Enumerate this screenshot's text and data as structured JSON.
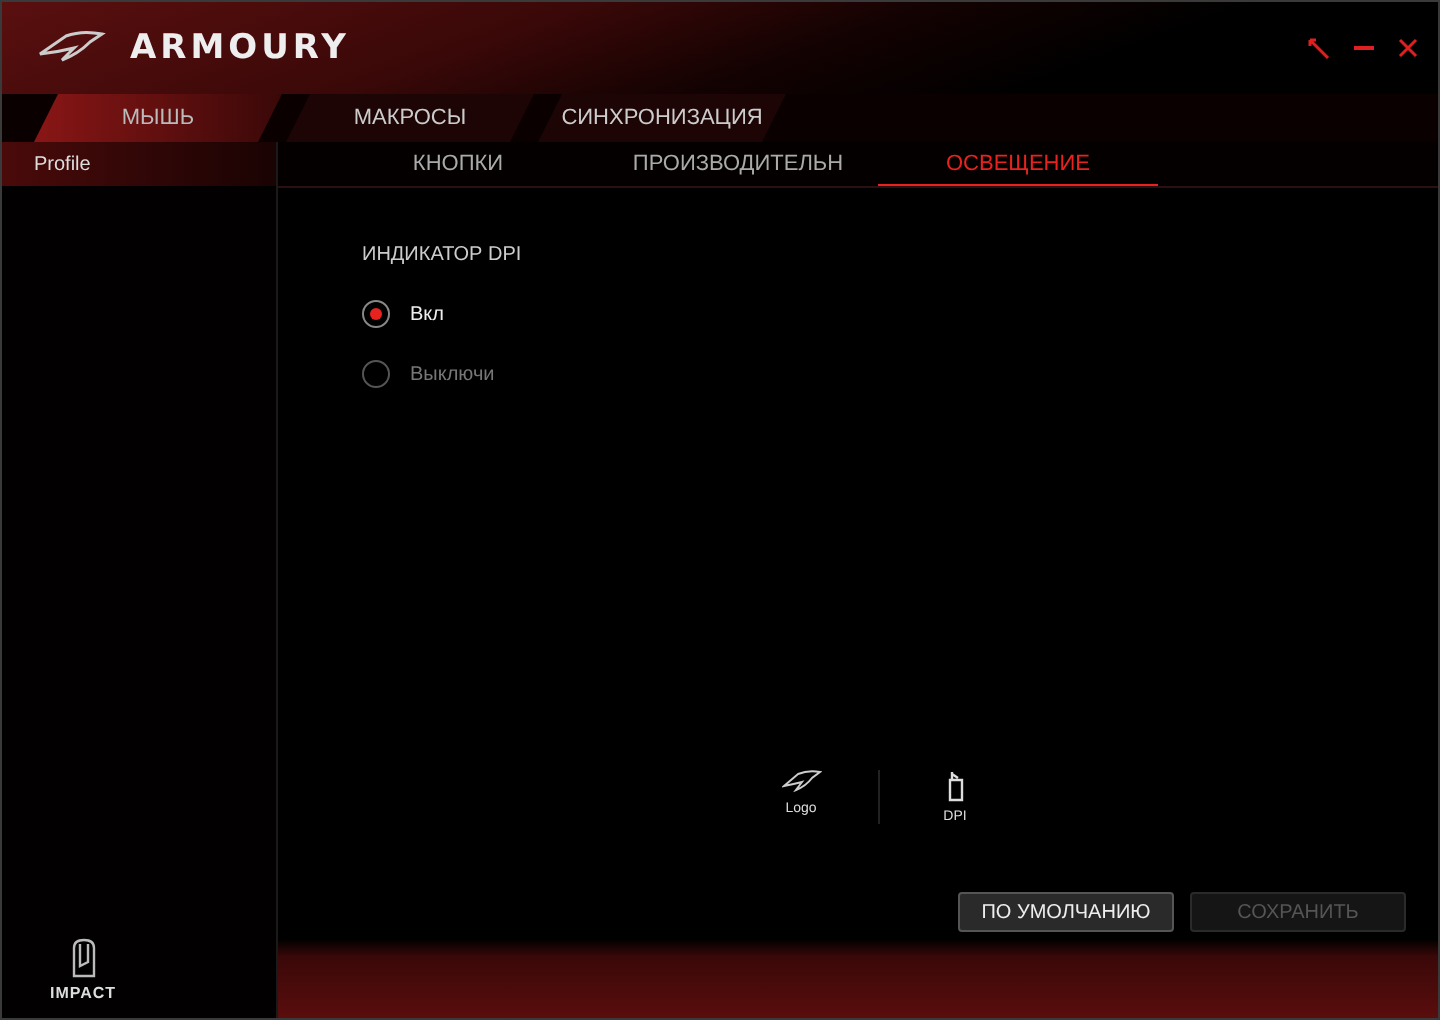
{
  "window": {
    "title": "ARMOURY"
  },
  "tabs": [
    {
      "label": "МЫШЬ",
      "selected": true
    },
    {
      "label": "МАКРОСЫ",
      "selected": false
    },
    {
      "label": "СИНХРОНИЗАЦИЯ",
      "selected": false
    }
  ],
  "sidebar": {
    "items": [
      {
        "label": "Profile",
        "selected": true
      }
    ],
    "device": "IMPACT"
  },
  "subtabs": [
    {
      "label": "КНОПКИ",
      "selected": false
    },
    {
      "label": "ПРОИЗВОДИТЕЛЬН",
      "selected": false
    },
    {
      "label": "ОСВЕЩЕНИЕ",
      "selected": true
    }
  ],
  "section": {
    "title": "ИНДИКАТОР DPI",
    "options": [
      {
        "label": "Вкл",
        "selected": true
      },
      {
        "label": "Выключи",
        "selected": false
      }
    ]
  },
  "zones": [
    {
      "kind": "logo",
      "label": "Logo"
    },
    {
      "kind": "dpi",
      "label": "DPI"
    }
  ],
  "buttons": [
    {
      "label": "ПО УМОЛЧАНИЮ",
      "disabled": false
    },
    {
      "label": "СОХРАНИТЬ",
      "disabled": true
    }
  ]
}
